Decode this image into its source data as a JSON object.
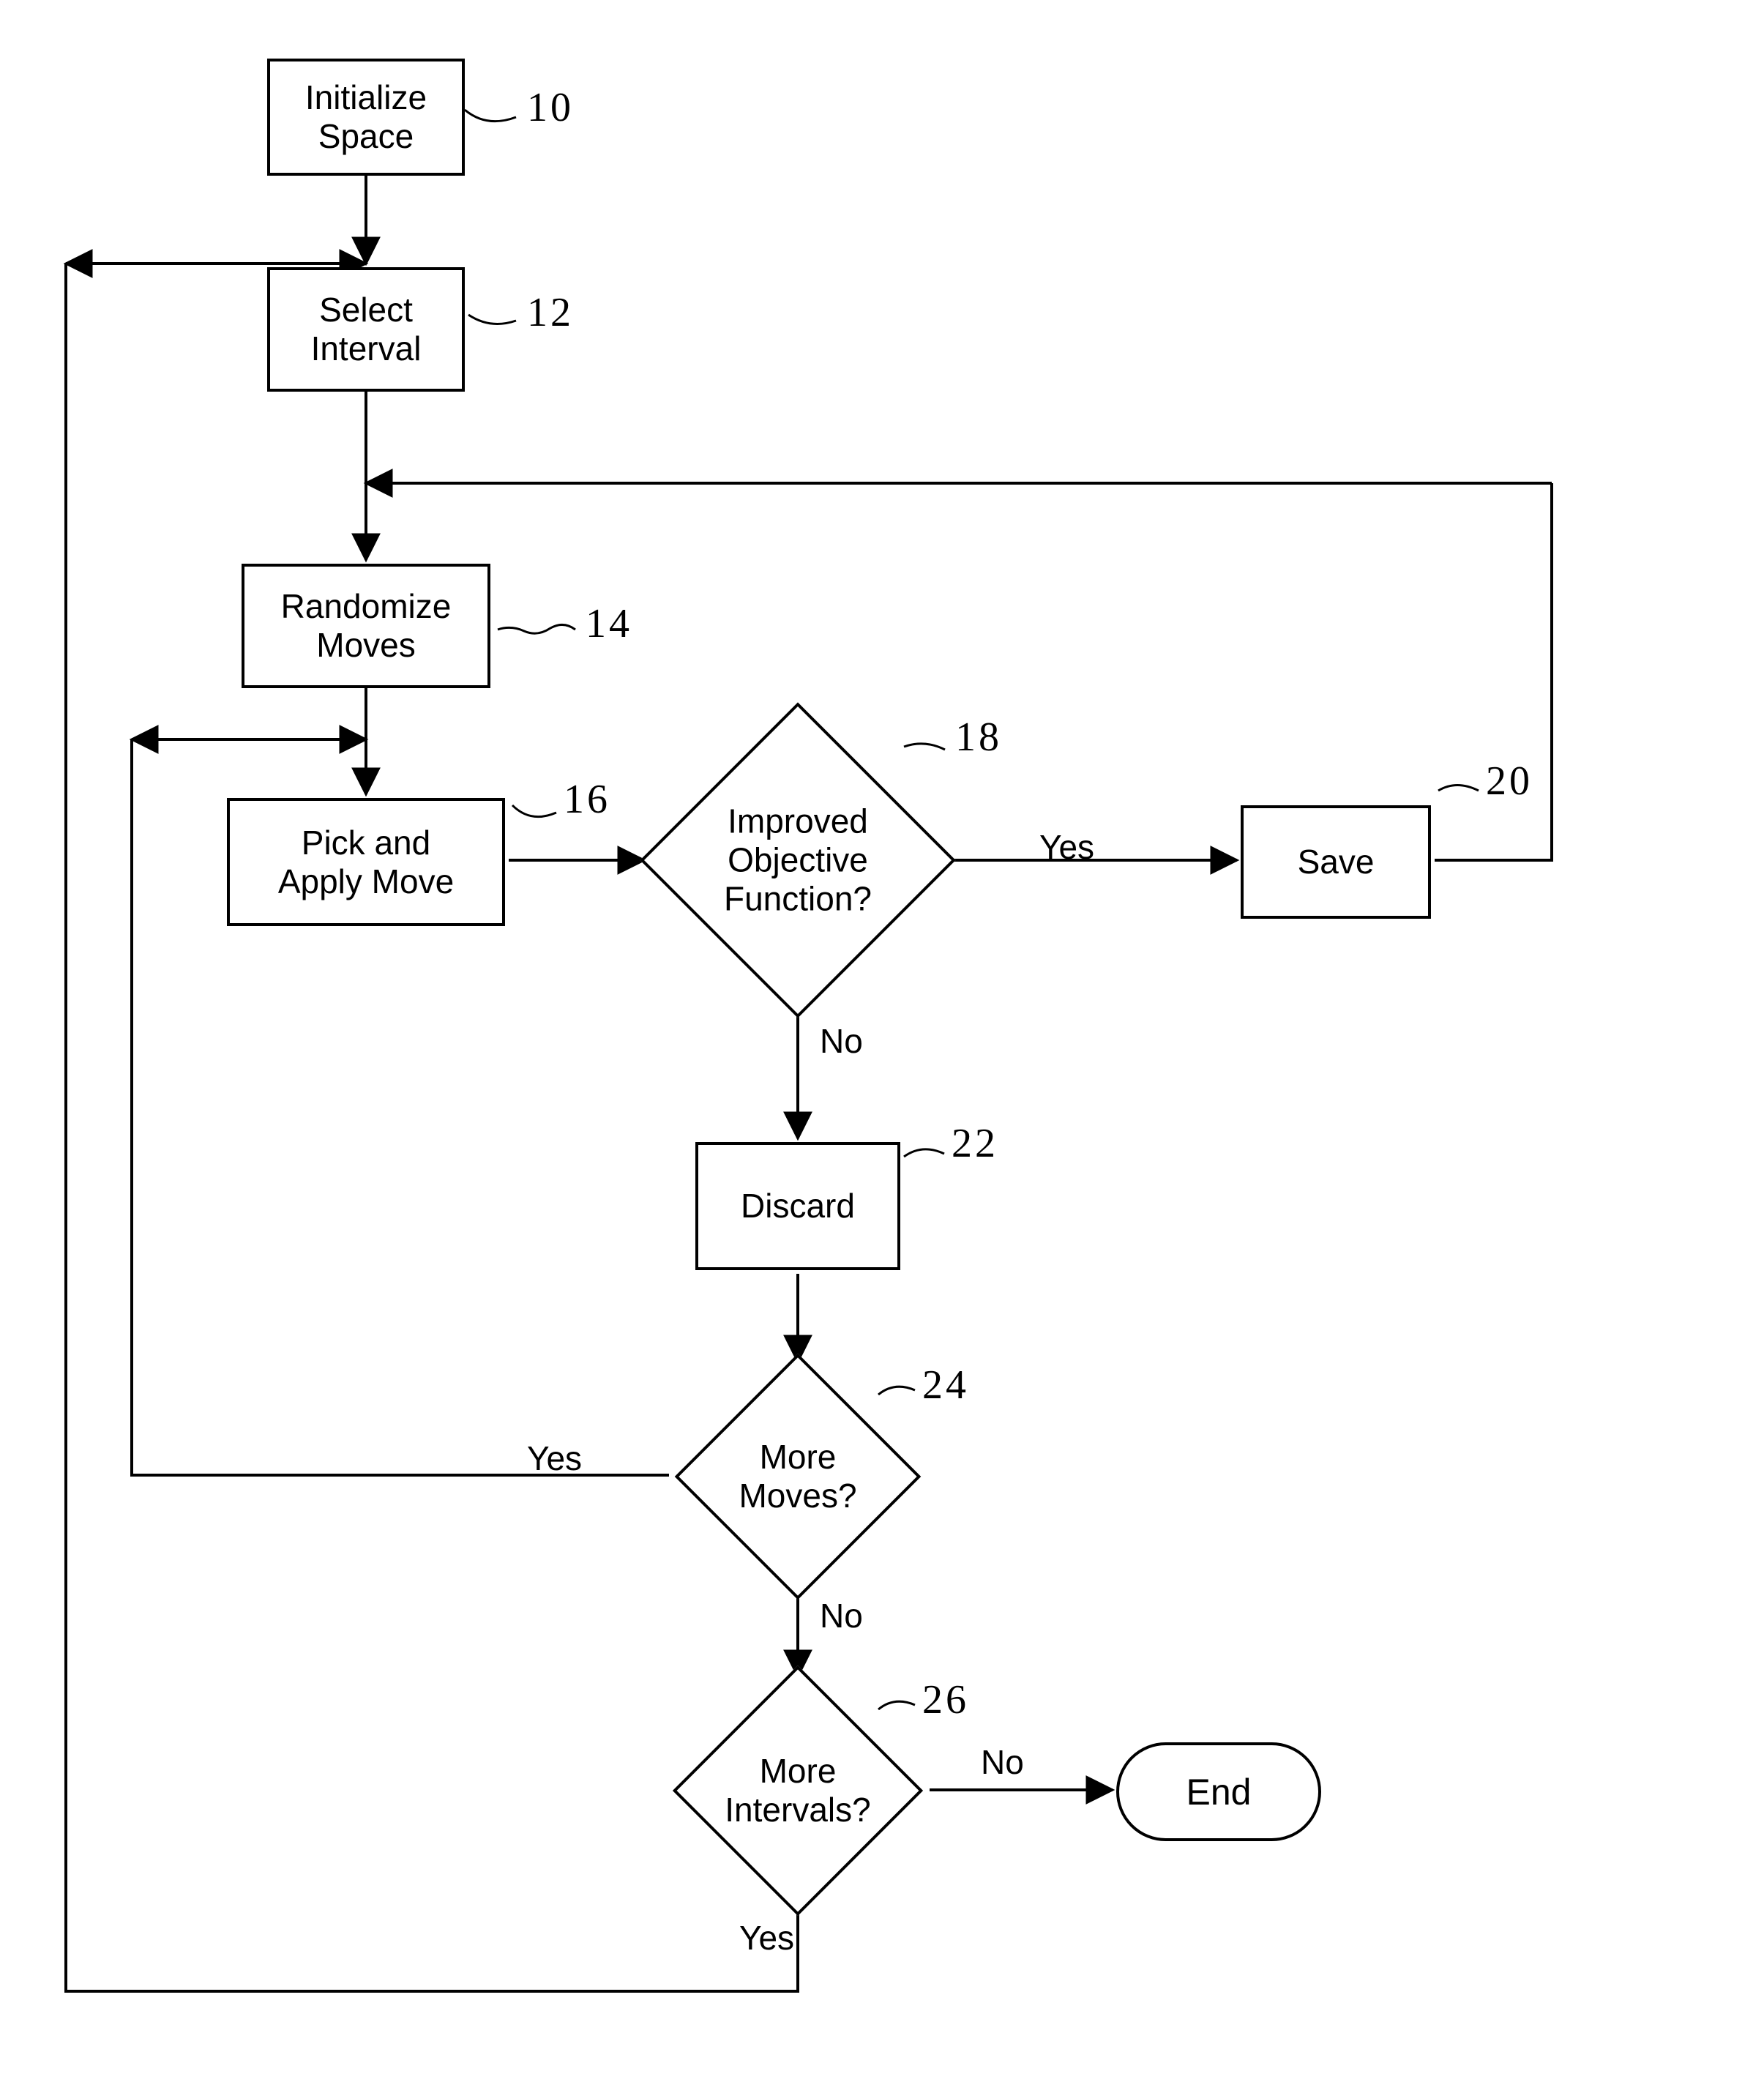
{
  "nodes": {
    "initialize": "Initialize\nSpace",
    "select_interval": "Select\nInterval",
    "randomize": "Randomize\nMoves",
    "pick_apply": "Pick and\nApply Move",
    "improved": "Improved\nObjective\nFunction?",
    "save": "Save",
    "discard": "Discard",
    "more_moves": "More\nMoves?",
    "more_intervals": "More\nIntervals?",
    "end": "End"
  },
  "labels": {
    "yes": "Yes",
    "no": "No"
  },
  "callouts": {
    "c10": "10",
    "c12": "12",
    "c14": "14",
    "c16": "16",
    "c18": "18",
    "c20": "20",
    "c22": "22",
    "c24": "24",
    "c26": "26"
  }
}
